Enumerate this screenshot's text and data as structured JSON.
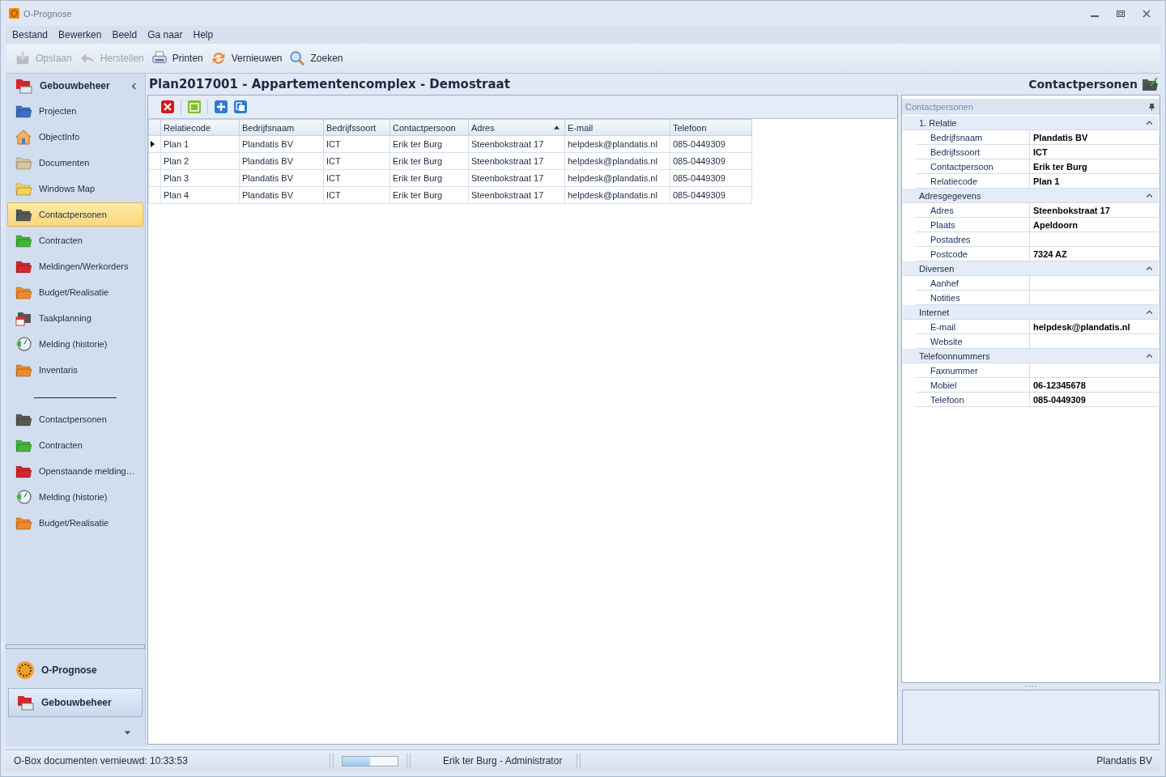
{
  "window": {
    "title": "O-Prognose"
  },
  "menu": [
    "Bestand",
    "Bewerken",
    "Beeld",
    "Ga naar",
    "Help"
  ],
  "toolbar": [
    {
      "label": "Opslaan",
      "kind": "save",
      "disabled": true
    },
    {
      "label": "Herstellen",
      "kind": "undo",
      "disabled": true
    },
    {
      "label": "Printen",
      "kind": "print",
      "disabled": false
    },
    {
      "label": "Vernieuwen",
      "kind": "refresh",
      "disabled": false
    },
    {
      "label": "Zoeken",
      "kind": "search",
      "disabled": false
    }
  ],
  "sidebar": {
    "title": "Gebouwbeheer",
    "items": [
      {
        "label": "Projecten",
        "kind": "projects",
        "selected": false
      },
      {
        "label": "ObjectInfo",
        "kind": "house",
        "selected": false
      },
      {
        "label": "Documenten",
        "kind": "documents",
        "selected": false
      },
      {
        "label": "Windows Map",
        "kind": "folder",
        "selected": false
      },
      {
        "label": "Contactpersonen",
        "kind": "contacts",
        "selected": true
      },
      {
        "label": "Contracten",
        "kind": "contracts",
        "selected": false
      },
      {
        "label": "Meldingen/Werkorders",
        "kind": "reports",
        "selected": false
      },
      {
        "label": "Budget/Realisatie",
        "kind": "budget",
        "selected": false
      },
      {
        "label": "Taakplanning",
        "kind": "planning",
        "selected": false
      },
      {
        "label": "Melding (historie)",
        "kind": "history",
        "selected": false
      },
      {
        "label": "Inventaris",
        "kind": "inventory",
        "selected": false
      }
    ],
    "items_2": [
      {
        "label": "Contactpersonen",
        "kind": "contacts",
        "selected": false
      },
      {
        "label": "Contracten",
        "kind": "contracts",
        "selected": false
      },
      {
        "label": "Openstaande melding…",
        "kind": "reports",
        "selected": false
      },
      {
        "label": "Melding (historie)",
        "kind": "history",
        "selected": false
      },
      {
        "label": "Budget/Realisatie",
        "kind": "budget",
        "selected": false
      }
    ],
    "modules": [
      {
        "label": "O-Prognose",
        "kind": "prognose",
        "selected": false
      },
      {
        "label": "Gebouwbeheer",
        "kind": "building",
        "selected": true
      }
    ]
  },
  "content": {
    "title": "Plan2017001 - Appartementencomplex - Demostraat",
    "section": "Contactpersonen"
  },
  "table": {
    "columns": [
      {
        "label": "Relatiecode",
        "sorted": false
      },
      {
        "label": "Bedrijfsnaam",
        "sorted": false
      },
      {
        "label": "Bedrijfssoort",
        "sorted": false
      },
      {
        "label": "Contactpersoon",
        "sorted": false
      },
      {
        "label": "Adres",
        "sorted": true
      },
      {
        "label": "E-mail",
        "sorted": false
      },
      {
        "label": "Telefoon",
        "sorted": false
      }
    ],
    "rows": [
      {
        "selected": true,
        "cells": [
          "Plan 1",
          "Plandatis BV",
          "ICT",
          "Erik ter Burg",
          "Steenbokstraat 17",
          "helpdesk@plandatis.nl",
          "085-0449309"
        ]
      },
      {
        "selected": false,
        "cells": [
          "Plan 2",
          "Plandatis BV",
          "ICT",
          "Erik ter Burg",
          "Steenbokstraat 17",
          "helpdesk@plandatis.nl",
          "085-0449309"
        ]
      },
      {
        "selected": false,
        "cells": [
          "Plan 3",
          "Plandatis BV",
          "ICT",
          "Erik ter Burg",
          "Steenbokstraat 17",
          "helpdesk@plandatis.nl",
          "085-0449309"
        ]
      },
      {
        "selected": false,
        "cells": [
          "Plan 4",
          "Plandatis BV",
          "ICT",
          "Erik ter Burg",
          "Steenbokstraat 17",
          "helpdesk@plandatis.nl",
          "085-0449309"
        ]
      }
    ]
  },
  "properties": {
    "title": "Contactpersonen",
    "categories": [
      {
        "label": "1. Relatie",
        "expanded": true,
        "rows": [
          {
            "label": "Bedrijfsnaam",
            "value": "Plandatis BV"
          },
          {
            "label": "Bedrijfssoort",
            "value": "ICT"
          },
          {
            "label": "Contactpersoon",
            "value": "Erik ter Burg"
          },
          {
            "label": "Relatiecode",
            "value": "Plan 1"
          }
        ]
      },
      {
        "label": "Adresgegevens",
        "expanded": true,
        "rows": [
          {
            "label": "Adres",
            "value": "Steenbokstraat 17"
          },
          {
            "label": "Plaats",
            "value": "Apeldoorn"
          },
          {
            "label": "Postadres"
          },
          {
            "label": "Postcode",
            "value": "7324 AZ"
          }
        ]
      },
      {
        "label": "Diversen",
        "expanded": true,
        "rows": [
          {
            "label": "Aanhef"
          },
          {
            "label": "Notities"
          }
        ]
      },
      {
        "label": "Internet",
        "expanded": true,
        "rows": [
          {
            "label": "E-mail",
            "value": "helpdesk@plandatis.nl"
          },
          {
            "label": "Website"
          }
        ]
      },
      {
        "label": "Telefoonnummers",
        "expanded": true,
        "rows": [
          {
            "label": "Faxnummer"
          },
          {
            "label": "Mobiel",
            "value": "06-12345678"
          },
          {
            "label": "Telefoon",
            "value": "085-0449309"
          }
        ]
      }
    ]
  },
  "status_bar": {
    "message": "O-Box documenten vernieuwd: 10:33:53",
    "level": 0.5,
    "user": "Erik ter Burg - Administrator",
    "company": "Plandatis BV"
  }
}
